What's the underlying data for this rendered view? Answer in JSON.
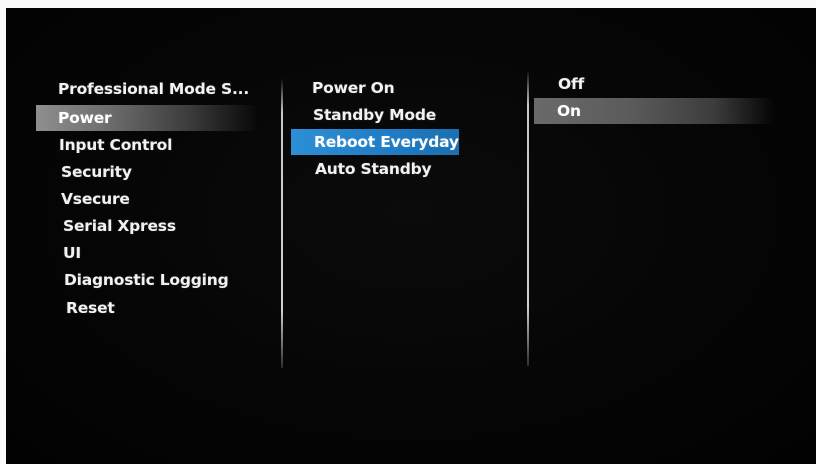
{
  "left_menu": {
    "title": "Professional Mode S...",
    "items": [
      {
        "label": "Power"
      },
      {
        "label": "Input Control"
      },
      {
        "label": "Security"
      },
      {
        "label": "Vsecure"
      },
      {
        "label": "Serial Xpress"
      },
      {
        "label": "UI"
      },
      {
        "label": "Diagnostic Logging"
      },
      {
        "label": "Reset"
      }
    ],
    "selected": "Power"
  },
  "middle_menu": {
    "items": [
      {
        "label": "Power On"
      },
      {
        "label": "Standby Mode"
      },
      {
        "label": "Reboot Everyday"
      },
      {
        "label": "Auto Standby"
      }
    ],
    "focused": "Reboot Everyday",
    "focus_color": "#1f7cc4"
  },
  "right_menu": {
    "items": [
      {
        "label": "Off"
      },
      {
        "label": "On"
      }
    ],
    "selected": "On"
  }
}
